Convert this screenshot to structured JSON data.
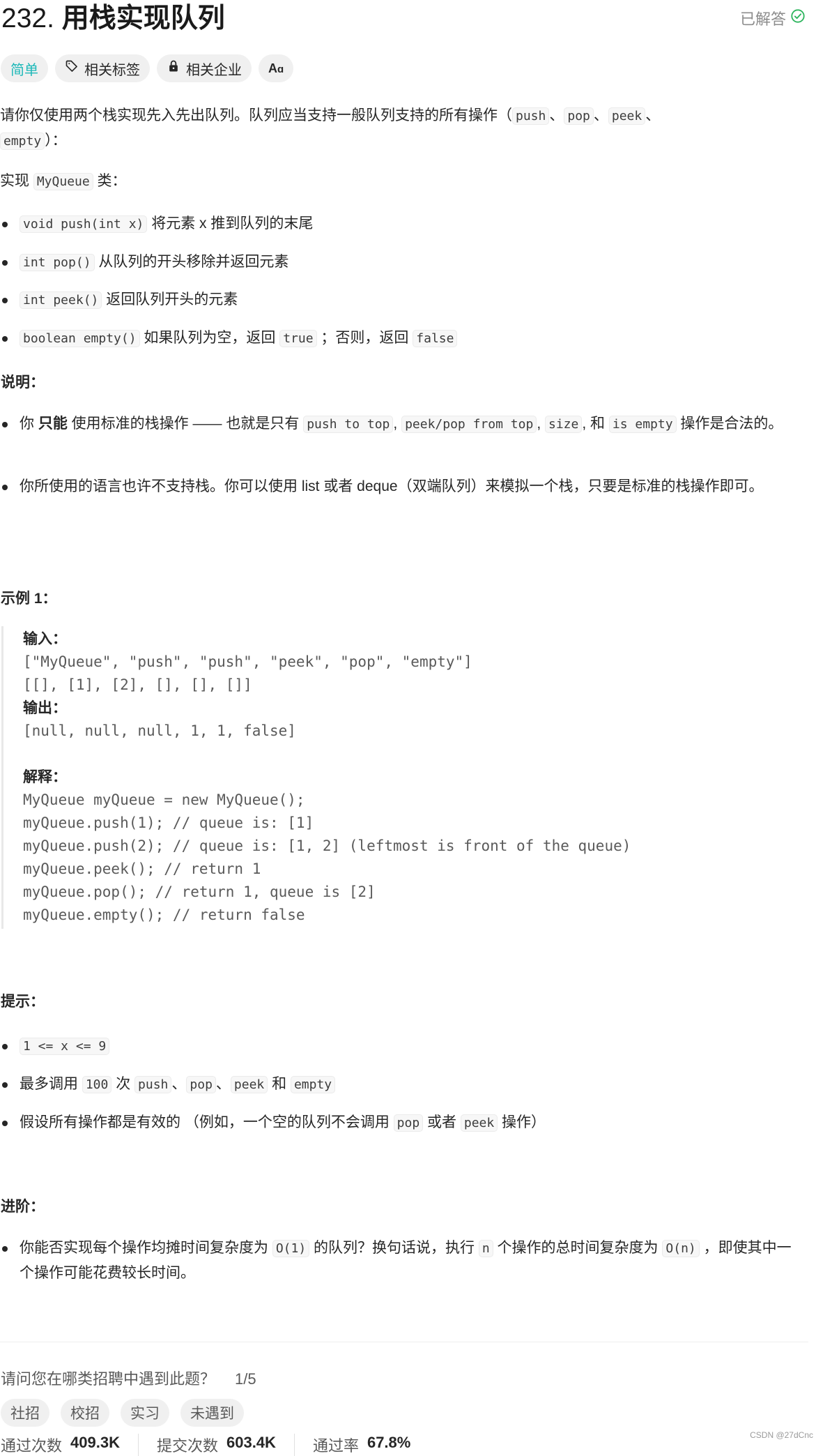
{
  "header": {
    "number": "232.",
    "title": "用栈实现队列",
    "status": "已解答",
    "status_color": "#2db55d"
  },
  "tags": {
    "difficulty": "简单",
    "difficulty_color": "#1cb8b8",
    "topics": "相关标签",
    "companies": "相关企业",
    "translate": "Aあ"
  },
  "description": {
    "intro_pre": "请你仅使用两个栈实现先入先出队列。队列应当支持一般队列支持的所有操作（",
    "intro_ops": [
      "push",
      "pop",
      "peek",
      "empty"
    ],
    "intro_post": "）：",
    "impl_pre": "实现 ",
    "impl_class": "MyQueue",
    "impl_post": " 类：",
    "methods": [
      {
        "code": "void push(int x)",
        "text": " 将元素 x 推到队列的末尾"
      },
      {
        "code": "int pop()",
        "text": " 从队列的开头移除并返回元素"
      },
      {
        "code": "int peek()",
        "text": " 返回队列开头的元素"
      },
      {
        "code": "boolean empty()",
        "text": " 如果队列为空，返回 ",
        "code2": "true",
        "text2": " ；否则，返回 ",
        "code3": "false"
      }
    ]
  },
  "notes": {
    "heading": "说明：",
    "n1_pre": "你 ",
    "n1_bold": "只能",
    "n1_mid": " 使用标准的栈操作 —— 也就是只有 ",
    "n1_c1": "push to top",
    "n1_c2": "peek/pop from top",
    "n1_c3": "size",
    "n1_and": ", 和 ",
    "n1_c4": "is empty",
    "n1_post": " 操作是合法的。",
    "n2": "你所使用的语言也许不支持栈。你可以使用 list 或者 deque（双端队列）来模拟一个栈，只要是标准的栈操作即可。"
  },
  "example": {
    "heading": "示例 1：",
    "input_label": "输入：",
    "input_lines": [
      "[\"MyQueue\", \"push\", \"push\", \"peek\", \"pop\", \"empty\"]",
      "[[], [1], [2], [], [], []]"
    ],
    "output_label": "输出：",
    "output_line": "[null, null, null, 1, 1, false]",
    "explain_label": "解释：",
    "explain_lines": [
      "MyQueue myQueue = new MyQueue();",
      "myQueue.push(1); // queue is: [1]",
      "myQueue.push(2); // queue is: [1, 2] (leftmost is front of the queue)",
      "myQueue.peek(); // return 1",
      "myQueue.pop(); // return 1, queue is [2]",
      "myQueue.empty(); // return false"
    ]
  },
  "constraints": {
    "heading": "提示：",
    "c1": "1 <= x <= 9",
    "c2_pre": "最多调用 ",
    "c2_n": "100",
    "c2_mid": " 次 ",
    "c2_ops": [
      "push",
      "pop",
      "peek"
    ],
    "c2_and": " 和 ",
    "c2_last": "empty",
    "c3_pre": "假设所有操作都是有效的 （例如，一个空的队列不会调用 ",
    "c3_c1": "pop",
    "c3_mid": " 或者 ",
    "c3_c2": "peek",
    "c3_post": " 操作）"
  },
  "followup": {
    "heading": "进阶：",
    "pre": "你能否实现每个操作均摊时间复杂度为 ",
    "c1": "O(1)",
    "mid": " 的队列？换句话说，执行 ",
    "c2": "n",
    "mid2": " 个操作的总时间复杂度为 ",
    "c3": "O(n)",
    "post": " ，即使其中一个操作可能花费较长时间。"
  },
  "survey": {
    "question": "请问您在哪类招聘中遇到此题？",
    "count": "1/5",
    "options": [
      "社招",
      "校招",
      "实习",
      "未遇到"
    ]
  },
  "stats": [
    {
      "label": "通过次数",
      "value": "409.3K"
    },
    {
      "label": "提交次数",
      "value": "603.4K"
    },
    {
      "label": "通过率",
      "value": "67.8%"
    }
  ],
  "watermark": "CSDN @27dCnc"
}
